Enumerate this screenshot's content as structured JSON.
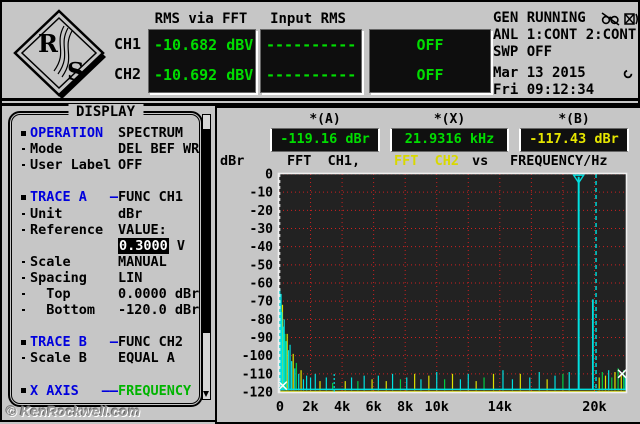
{
  "header": {
    "logo": {
      "letter1": "R",
      "letter2": "S",
      "icon": "rohde-schwarz-logo"
    },
    "rms_via_fft": {
      "title": "RMS via FFT",
      "ch1_label": "CH1",
      "ch2_label": "CH2",
      "ch1_value": "-10.682 dBV",
      "ch2_value": "-10.692 dBV"
    },
    "input_rms": {
      "title": "Input RMS",
      "row1": "----------",
      "row2": "----------"
    },
    "off_box": {
      "row1": "OFF",
      "row2": "OFF"
    },
    "status": {
      "gen": "GEN RUNNING",
      "anl": "ANL 1:CONT 2:CONT",
      "swp": "SWP OFF",
      "date": "Mar 13 2015",
      "time": "Fri 09:12:34",
      "icons": [
        "muted-monitor-icon",
        "muted-speaker-icon",
        "rotate-icon"
      ]
    }
  },
  "display_panel": {
    "title": "DISPLAY",
    "rows": [
      {
        "bullet": "sq",
        "label": "OPERATION",
        "label_blue": true,
        "value": "SPECTRUM"
      },
      {
        "bullet": "dot",
        "label": "Mode",
        "value": "DEL BEF WR"
      },
      {
        "bullet": "dot",
        "label": "User Label",
        "value": "OFF"
      },
      {
        "spacer": true
      },
      {
        "bullet": "sq",
        "label": "TRACE A",
        "label_blue": true,
        "dash": "—",
        "value": "FUNC CH1"
      },
      {
        "bullet": "dot",
        "label": "Unit",
        "value": "dBr"
      },
      {
        "bullet": "dot",
        "label": "Reference",
        "value": "VALUE:"
      },
      {
        "bullet": "",
        "label": "",
        "value": "0.3000",
        "value_hl": true,
        "suffix": " V"
      },
      {
        "bullet": "dot",
        "label": "Scale",
        "value": "MANUAL"
      },
      {
        "bullet": "dot",
        "label": "Spacing",
        "value": "LIN"
      },
      {
        "bullet": "dot",
        "label": "  Top",
        "value": "0.0000 dBr"
      },
      {
        "bullet": "dot",
        "label": "  Bottom",
        "value": "-120.0 dBr"
      },
      {
        "spacer": true
      },
      {
        "bullet": "sq",
        "label": "TRACE B",
        "label_blue": true,
        "dash": "—",
        "value": "FUNC CH2"
      },
      {
        "bullet": "dot",
        "label": "Scale B",
        "value": "EQUAL A"
      },
      {
        "spacer": true
      },
      {
        "bullet": "sq",
        "label": "X AXIS",
        "label_blue": true,
        "dash": "——",
        "value": "FREQUENCY",
        "value_green": true
      }
    ]
  },
  "watermark": "© KenRockwell.com",
  "chart_data": {
    "type": "line",
    "subtype": "fft-spectrum",
    "markers": {
      "a_label": "*(A)",
      "a_value": "-119.16 dBr",
      "x_label": "*(X)",
      "x_value": "21.9316 kHz",
      "b_label": "*(B)",
      "b_value": "-117.43 dBr"
    },
    "title_parts": {
      "ylabel": "dBr",
      "trace_a": "FFT  CH1,",
      "trace_b": "FFT  CH2",
      "vs": "vs",
      "xlabel": "FREQUENCY/Hz"
    },
    "ylim": [
      -120,
      0
    ],
    "y_ticks": [
      0,
      -10,
      -20,
      -30,
      -40,
      -50,
      -60,
      -70,
      -80,
      -90,
      -100,
      -110,
      -120
    ],
    "xlim_khz": [
      0,
      22
    ],
    "x_ticks": [
      {
        "khz": 0,
        "label": "0"
      },
      {
        "khz": 2,
        "label": "2k"
      },
      {
        "khz": 4,
        "label": "4k"
      },
      {
        "khz": 6,
        "label": "6k"
      },
      {
        "khz": 8,
        "label": "8k"
      },
      {
        "khz": 10,
        "label": "10k"
      },
      {
        "khz": 14,
        "label": "14k"
      },
      {
        "khz": 20,
        "label": "20k"
      }
    ],
    "grid": {
      "x_step_khz": 2,
      "y_step_db": 10,
      "color": "#cc2020",
      "style": "dotted"
    },
    "plot_bg": "#222222",
    "trace_colors": {
      "c": "#00e0e0",
      "y": "#e0e000",
      "g": "#00cc44",
      "w": "#ffffff"
    },
    "baseline_db": -118.5,
    "main_peaks": [
      {
        "khz": 19.0,
        "db": -1.5,
        "color": "c",
        "marker": "triangle-down"
      },
      {
        "khz": 19.9,
        "db": -69,
        "color": "c"
      }
    ],
    "dashed_spike": {
      "khz": 3.5,
      "db": -109,
      "color": "c"
    },
    "cursor": {
      "khz": 20.1,
      "color": "c",
      "style": "dashed"
    },
    "left_cursor": {
      "khz": 0.05,
      "color": "w",
      "style": "dashed",
      "mark_db": -116.5
    },
    "right_mark": {
      "khz": 21.75,
      "db": -110,
      "symbol": "x",
      "color": "w"
    },
    "noise_spikes": [
      [
        0.05,
        -63,
        "c"
      ],
      [
        0.09,
        -70,
        "c"
      ],
      [
        0.13,
        -66,
        "c"
      ],
      [
        0.18,
        -76,
        "c"
      ],
      [
        0.22,
        -72,
        "y"
      ],
      [
        0.28,
        -84,
        "c"
      ],
      [
        0.33,
        -80,
        "c"
      ],
      [
        0.38,
        -88,
        "g"
      ],
      [
        0.45,
        -92,
        "c"
      ],
      [
        0.52,
        -88,
        "y"
      ],
      [
        0.6,
        -97,
        "c"
      ],
      [
        0.7,
        -94,
        "c"
      ],
      [
        0.8,
        -103,
        "c"
      ],
      [
        0.9,
        -99,
        "y"
      ],
      [
        1.0,
        -107,
        "c"
      ],
      [
        1.1,
        -104,
        "g"
      ],
      [
        1.25,
        -110,
        "c"
      ],
      [
        1.4,
        -108,
        "y"
      ],
      [
        1.55,
        -113,
        "c"
      ],
      [
        1.75,
        -111,
        "c"
      ],
      [
        2.0,
        -112,
        "c"
      ],
      [
        2.3,
        -110,
        "c"
      ],
      [
        2.6,
        -114,
        "y"
      ],
      [
        3.0,
        -112,
        "c"
      ],
      [
        3.4,
        -115,
        "g"
      ],
      [
        4.2,
        -114,
        "y"
      ],
      [
        4.6,
        -112,
        "c"
      ],
      [
        5.0,
        -114,
        "g"
      ],
      [
        5.4,
        -111,
        "c"
      ],
      [
        5.9,
        -113,
        "y"
      ],
      [
        6.3,
        -111,
        "c"
      ],
      [
        6.8,
        -114,
        "y"
      ],
      [
        7.2,
        -110,
        "c"
      ],
      [
        7.7,
        -113,
        "g"
      ],
      [
        8.1,
        -112,
        "c"
      ],
      [
        8.6,
        -110,
        "y"
      ],
      [
        9.0,
        -113,
        "c"
      ],
      [
        9.5,
        -111,
        "y"
      ],
      [
        10.0,
        -109,
        "c"
      ],
      [
        10.5,
        -113,
        "g"
      ],
      [
        11.0,
        -110,
        "y"
      ],
      [
        11.5,
        -113,
        "c"
      ],
      [
        12.0,
        -110,
        "c"
      ],
      [
        12.5,
        -114,
        "y"
      ],
      [
        13.0,
        -112,
        "g"
      ],
      [
        13.6,
        -110,
        "y"
      ],
      [
        14.2,
        -108,
        "c"
      ],
      [
        14.8,
        -113,
        "c"
      ],
      [
        15.3,
        -110,
        "y"
      ],
      [
        15.9,
        -112,
        "c"
      ],
      [
        16.5,
        -109,
        "c"
      ],
      [
        17.0,
        -113,
        "y"
      ],
      [
        17.5,
        -111,
        "c"
      ],
      [
        18.0,
        -110,
        "g"
      ],
      [
        18.4,
        -109,
        "c"
      ],
      [
        20.3,
        -112,
        "y"
      ],
      [
        20.5,
        -109,
        "g"
      ],
      [
        20.7,
        -111,
        "y"
      ],
      [
        20.9,
        -108,
        "c"
      ],
      [
        21.1,
        -112,
        "g"
      ],
      [
        21.3,
        -109,
        "y"
      ],
      [
        21.5,
        -107,
        "g"
      ],
      [
        21.7,
        -110,
        "y"
      ],
      [
        21.85,
        -108,
        "g"
      ],
      [
        21.95,
        -111,
        "c"
      ]
    ]
  }
}
